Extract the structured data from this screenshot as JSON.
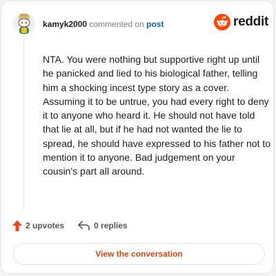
{
  "comment": {
    "username": "kamyk2000",
    "action_text": "commented on",
    "target_link": "post",
    "body": "NTA. You were nothing but supportive right up until he panicked and lied to his biological father, telling him a shocking incest type story as a cover. Assuming it to be untrue, you had every right to deny it to anyone who heard it. He should not have told that lie at all, but if he had not wanted the lie to spread, he should have expressed to his father not to mention it to anyone. Bad judgement on your cousin's part all around."
  },
  "brand": {
    "name": "reddit",
    "color": "#ff4500"
  },
  "stats": {
    "upvotes_label": "2 upvotes",
    "replies_label": "0 replies"
  },
  "cta": {
    "label": "View the conversation"
  },
  "icons": {
    "avatar": "snoo-avatar-icon",
    "logo": "reddit-logo-icon",
    "upvote": "upvote-arrow-icon",
    "reply": "reply-arrow-icon"
  }
}
